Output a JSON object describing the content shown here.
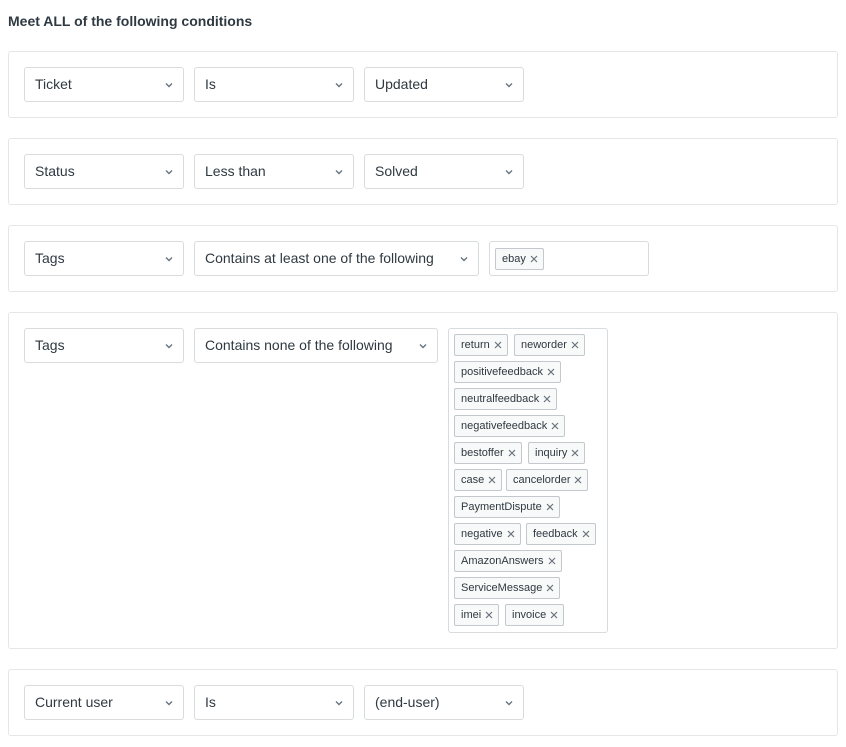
{
  "heading": "Meet ALL of the following conditions",
  "icons": {
    "dropdown": "chevron-down-icon",
    "remove": "close-icon"
  },
  "rows": [
    {
      "field": "Ticket",
      "operator": "Is",
      "value": "Updated"
    },
    {
      "field": "Status",
      "operator": "Less than",
      "value": "Solved"
    },
    {
      "field": "Tags",
      "operator": "Contains at least one of the following",
      "tags": [
        "ebay"
      ]
    },
    {
      "field": "Tags",
      "operator": "Contains none of the following",
      "tags": [
        "return",
        "neworder",
        "positivefeedback",
        "neutralfeedback",
        "negativefeedback",
        "bestoffer",
        "inquiry",
        "case",
        "cancelorder",
        "PaymentDispute",
        "negative",
        "feedback",
        "AmazonAnswers",
        "ServiceMessage",
        "imei",
        "invoice"
      ]
    },
    {
      "field": "Current user",
      "operator": "Is",
      "value": "(end-user)"
    }
  ]
}
